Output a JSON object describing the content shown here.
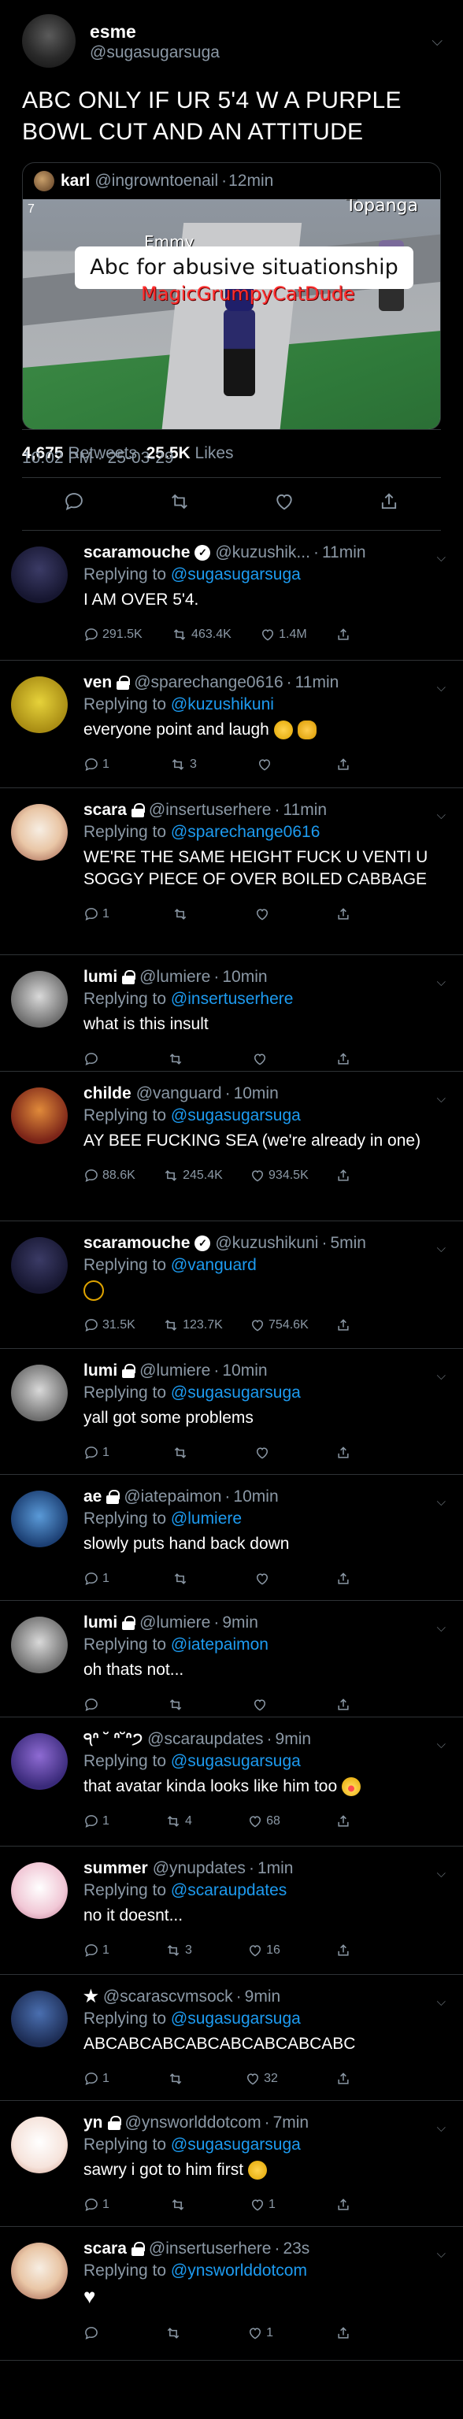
{
  "main": {
    "author_name": "esme",
    "author_handle": "@sugasugarsuga",
    "text": "ABC ONLY IF UR 5'4 W A PURPLE BOWL CUT AND AN ATTITUDE",
    "quote": {
      "name": "karl",
      "handle": "@ingrowntoenail",
      "time": "12min",
      "scene_number": "7",
      "npc_name": "Topanga",
      "player_label": "Emmy",
      "bubble_text": "Abc for abusive situationship",
      "player_name": "MagicGrumpyCatDude"
    },
    "timestamp": "10:02 PM · 25-03-29",
    "retweets_count": "4,675",
    "retweets_label": "Retweets",
    "likes_count": "25.5K",
    "likes_label": "Likes"
  },
  "replies": [
    {
      "name": "scaramouche",
      "handle": "@kuzushik...",
      "time": "11min",
      "replying": "Replying to",
      "to": "@sugasugarsuga",
      "text": "I AM OVER 5'4.",
      "reply_count": "291.5K",
      "rt_count": "463.4K",
      "like_count": "1.4M"
    },
    {
      "name": "ven",
      "handle": "@sparechange0616",
      "time": "11min",
      "replying": "Replying to",
      "to": "@kuzushikuni",
      "text": "everyone point and laugh",
      "reply_count": "1",
      "rt_count": "3",
      "like_count": ""
    },
    {
      "name": "scara",
      "handle": "@insertuserhere",
      "time": "11min",
      "replying": "Replying to",
      "to": "@sparechange0616",
      "text": "WE'RE THE SAME HEIGHT FUCK U VENTI U SOGGY PIECE OF OVER BOILED CABBAGE",
      "reply_count": "1",
      "rt_count": "",
      "like_count": ""
    },
    {
      "name": "lumi",
      "handle": "@lumiere",
      "time": "10min",
      "replying": "Replying to",
      "to": "@insertuserhere",
      "text": "what is this insult",
      "reply_count": "",
      "rt_count": "",
      "like_count": ""
    },
    {
      "name": "childe",
      "handle": "@vanguard",
      "time": "10min",
      "replying": "Replying to",
      "to": "@sugasugarsuga",
      "text": "AY BEE FUCKING SEA (we're already in one)",
      "reply_count": "88.6K",
      "rt_count": "245.4K",
      "like_count": "934.5K"
    },
    {
      "name": "scaramouche",
      "handle": "@kuzushikuni",
      "time": "5min",
      "replying": "Replying to",
      "to": "@vanguard",
      "text": "",
      "reply_count": "31.5K",
      "rt_count": "123.7K",
      "like_count": "754.6K"
    },
    {
      "name": "lumi",
      "handle": "@lumiere",
      "time": "10min",
      "replying": "Replying to",
      "to": "@sugasugarsuga",
      "text": "yall got some problems",
      "reply_count": "1",
      "rt_count": "",
      "like_count": ""
    },
    {
      "name": "ae",
      "handle": "@iatepaimon",
      "time": "10min",
      "replying": "Replying to",
      "to": "@lumiere",
      "text": "slowly puts hand back down",
      "reply_count": "1",
      "rt_count": "",
      "like_count": ""
    },
    {
      "name": "lumi",
      "handle": "@lumiere",
      "time": "9min",
      "replying": "Replying to",
      "to": "@iatepaimon",
      "text": "oh thats not...",
      "reply_count": "",
      "rt_count": "",
      "like_count": ""
    },
    {
      "name": "੧ᐢ ˘ ᐢ˘ᐢ੭",
      "handle": "@scaraupdates",
      "time": "9min",
      "replying": "Replying to",
      "to": "@sugasugarsuga",
      "text": "that avatar kinda looks like him too",
      "reply_count": "1",
      "rt_count": "4",
      "like_count": "68"
    },
    {
      "name": "summer",
      "handle": "@ynupdates",
      "time": "1min",
      "replying": "Replying to",
      "to": "@scaraupdates",
      "text": "no it doesnt...",
      "reply_count": "1",
      "rt_count": "3",
      "like_count": "16"
    },
    {
      "name": "★",
      "handle": "@scarascvmsock",
      "time": "9min",
      "replying": "Replying to",
      "to": "@sugasugarsuga",
      "text": "ABCABCABCABCABCABCABCABC",
      "reply_count": "1",
      "rt_count": "",
      "like_count": "32"
    },
    {
      "name": "yn",
      "handle": "@ynsworlddotcom",
      "time": "7min",
      "replying": "Replying to",
      "to": "@sugasugarsuga",
      "text": "sawry i got to him first",
      "reply_count": "1",
      "rt_count": "",
      "like_count": "1"
    },
    {
      "name": "scara",
      "handle": "@insertuserhere",
      "time": "23s",
      "replying": "Replying to",
      "to": "@ynsworlddotcom",
      "text": "",
      "reply_count": "",
      "rt_count": "",
      "like_count": "1"
    }
  ],
  "colors": {
    "background": "#000000",
    "link": "#1d9bf0",
    "muted": "#8b98a5",
    "divider": "#2f3336"
  }
}
